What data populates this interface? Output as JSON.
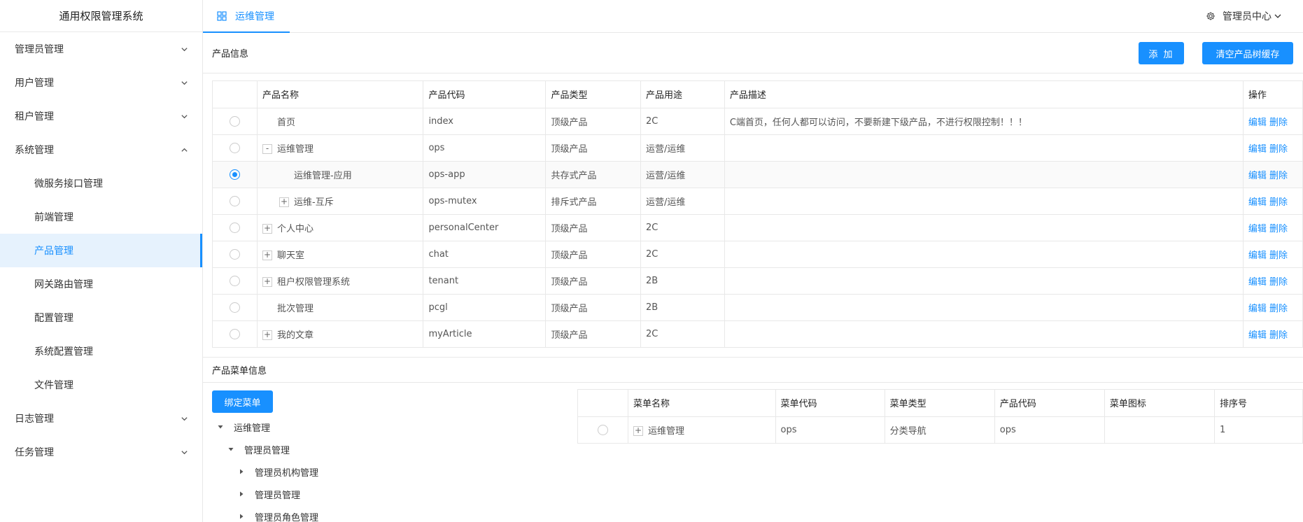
{
  "app": {
    "title": "通用权限管理系统"
  },
  "sidebar": {
    "items": [
      {
        "label": "管理员管理",
        "level": 1,
        "expanded": false
      },
      {
        "label": "用户管理",
        "level": 1,
        "expanded": false
      },
      {
        "label": "租户管理",
        "level": 1,
        "expanded": false
      },
      {
        "label": "系统管理",
        "level": 1,
        "expanded": true
      },
      {
        "label": "微服务接口管理",
        "level": 2
      },
      {
        "label": "前端管理",
        "level": 2
      },
      {
        "label": "产品管理",
        "level": 2,
        "active": true
      },
      {
        "label": "网关路由管理",
        "level": 2
      },
      {
        "label": "配置管理",
        "level": 2
      },
      {
        "label": "系统配置管理",
        "level": 2
      },
      {
        "label": "文件管理",
        "level": 2
      },
      {
        "label": "日志管理",
        "level": 1,
        "expanded": false
      },
      {
        "label": "任务管理",
        "level": 1,
        "expanded": false
      }
    ]
  },
  "topbar": {
    "tab_label": "运维管理",
    "admin_center": "管理员中心"
  },
  "product_section": {
    "title": "产品信息",
    "add_label": "添 加",
    "clear_label": "清空产品树缓存",
    "columns": [
      "产品名称",
      "产品代码",
      "产品类型",
      "产品用途",
      "产品描述",
      "操作"
    ],
    "rows": [
      {
        "name": "首页",
        "code": "index",
        "type": "顶级产品",
        "usage": "2C",
        "desc": "C端首页，任何人都可以访问，不要新建下级产品，不进行权限控制！！！",
        "indent": 0,
        "expander": "",
        "selected": false
      },
      {
        "name": "运维管理",
        "code": "ops",
        "type": "顶级产品",
        "usage": "运营/运维",
        "desc": "",
        "indent": 0,
        "expander": "-",
        "selected": false
      },
      {
        "name": "运维管理-应用",
        "code": "ops-app",
        "type": "共存式产品",
        "usage": "运营/运维",
        "desc": "",
        "indent": 1,
        "expander": "",
        "selected": true
      },
      {
        "name": "运维-互斥",
        "code": "ops-mutex",
        "type": "排斥式产品",
        "usage": "运营/运维",
        "desc": "",
        "indent": 1,
        "expander": "+",
        "selected": false
      },
      {
        "name": "个人中心",
        "code": "personalCenter",
        "type": "顶级产品",
        "usage": "2C",
        "desc": "",
        "indent": 0,
        "expander": "+",
        "selected": false
      },
      {
        "name": "聊天室",
        "code": "chat",
        "type": "顶级产品",
        "usage": "2C",
        "desc": "",
        "indent": 0,
        "expander": "+",
        "selected": false
      },
      {
        "name": "租户权限管理系统",
        "code": "tenant",
        "type": "顶级产品",
        "usage": "2B",
        "desc": "",
        "indent": 0,
        "expander": "+",
        "selected": false
      },
      {
        "name": "批次管理",
        "code": "pcgl",
        "type": "顶级产品",
        "usage": "2B",
        "desc": "",
        "indent": 0,
        "expander": "",
        "selected": false
      },
      {
        "name": "我的文章",
        "code": "myArticle",
        "type": "顶级产品",
        "usage": "2C",
        "desc": "",
        "indent": 0,
        "expander": "+",
        "selected": false
      }
    ],
    "edit_label": "编辑",
    "delete_label": "删除"
  },
  "menu_section": {
    "title": "产品菜单信息",
    "bind_label": "绑定菜单",
    "tree": [
      {
        "label": "运维管理",
        "level": 0,
        "open": true
      },
      {
        "label": "管理员管理",
        "level": 1,
        "open": true
      },
      {
        "label": "管理员机构管理",
        "level": 2,
        "open": false
      },
      {
        "label": "管理员管理",
        "level": 2,
        "open": false
      },
      {
        "label": "管理员角色管理",
        "level": 2,
        "open": false
      }
    ],
    "columns": [
      "菜单名称",
      "菜单代码",
      "菜单类型",
      "产品代码",
      "菜单图标",
      "排序号"
    ],
    "rows": [
      {
        "name": "运维管理",
        "code": "ops",
        "type": "分类导航",
        "product_code": "ops",
        "icon": "",
        "order": "1"
      }
    ]
  }
}
